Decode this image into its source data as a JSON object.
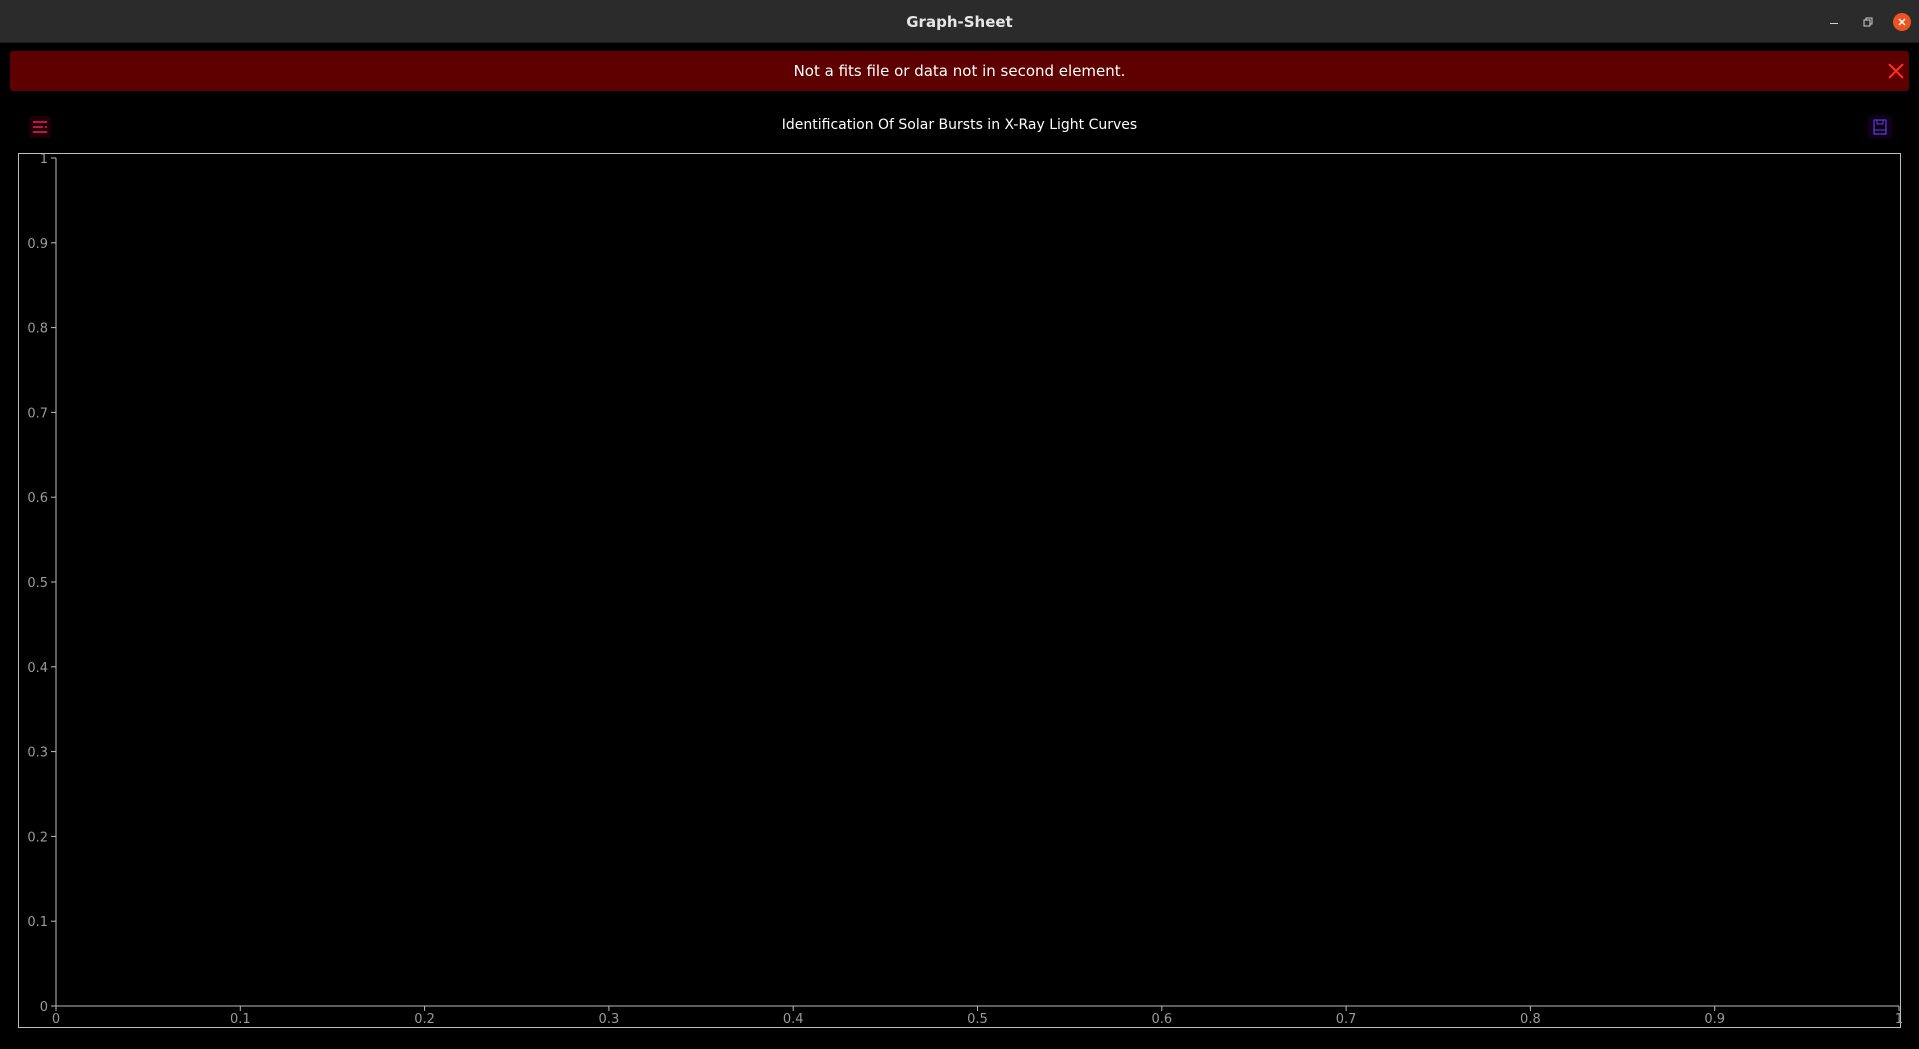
{
  "window": {
    "title": "Graph-Sheet",
    "controls": {
      "minimize_icon": "minimize-icon",
      "maximize_icon": "restore-icon",
      "close_icon": "close-icon"
    }
  },
  "banner": {
    "message": "Not a fits file or data not in second element.",
    "background": "#5e0000",
    "close_icon": "close-icon",
    "close_color": "#ff2a2a"
  },
  "toolbar": {
    "menu_icon": "menu-icon",
    "save_icon": "save-icon",
    "menu_color": "#e0245e",
    "save_color": "#5a3fd6"
  },
  "plot": {
    "title": "Identification Of Solar Bursts in X-Ray Light Curves"
  },
  "chart_data": {
    "type": "line",
    "title": "Identification Of Solar Bursts in X-Ray Light Curves",
    "xlabel": "",
    "ylabel": "",
    "series": [],
    "xlim": [
      0,
      1
    ],
    "ylim": [
      0,
      1
    ],
    "x_ticks": [
      "0",
      "0.1",
      "0.2",
      "0.3",
      "0.4",
      "0.5",
      "0.6",
      "0.7",
      "0.8",
      "0.9",
      "1"
    ],
    "y_ticks": [
      "0",
      "0.1",
      "0.2",
      "0.3",
      "0.4",
      "0.5",
      "0.6",
      "0.7",
      "0.8",
      "0.9",
      "1"
    ],
    "grid": false,
    "legend": "none"
  }
}
